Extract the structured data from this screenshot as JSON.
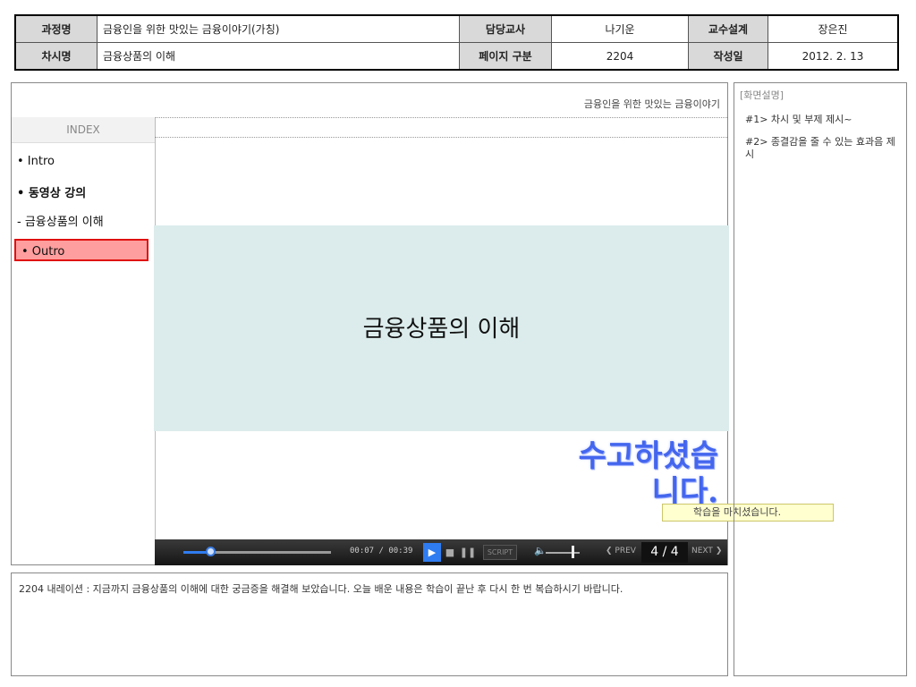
{
  "header": {
    "course_label": "과정명",
    "course_value": "금융인을 위한 맛있는 금융이야기(가칭)",
    "teacher_label": "담당교사",
    "teacher_value": "나기운",
    "design_label": "교수설계",
    "design_value": "장은진",
    "session_label": "차시명",
    "session_value": "금융상품의 이해",
    "page_label": "페이지 구분",
    "page_value": "2204",
    "date_label": "작성일",
    "date_value": "2012. 2. 13"
  },
  "screen": {
    "breadcrumb": "금융인을 위한 맛있는 금융이야기",
    "index_title": "INDEX",
    "index_items": [
      "• Intro",
      "• 동영상 강의",
      " - 금융상품의 이해",
      "• Outro"
    ],
    "title": "금융상품의 이해",
    "thanks_line1": "수고하셨습",
    "thanks_line2": "니다.",
    "tooltip": "학습을 마치셨습니다."
  },
  "player": {
    "progress": 0.18,
    "time": "00:07 / 00:39",
    "script_label": "SCRIPT",
    "prev_label": "PREV",
    "next_label": "NEXT",
    "page_indicator": "4 / 4",
    "accent_color": "#2f7cf0",
    "volume": 0.8
  },
  "notes": {
    "label": "[화면설명]",
    "items": [
      "#1> 차시 및 부제 제시~",
      "#2> 종결감을 줄 수 있는 효과음 제시"
    ]
  },
  "narration": "2204 내레이션 : 지금까지 금융상품의 이해에 대한 궁금증을 해결해 보았습니다. 오늘 배운 내용은 학습이 끝난 후 다시 한 번 복습하시기 바랍니다."
}
